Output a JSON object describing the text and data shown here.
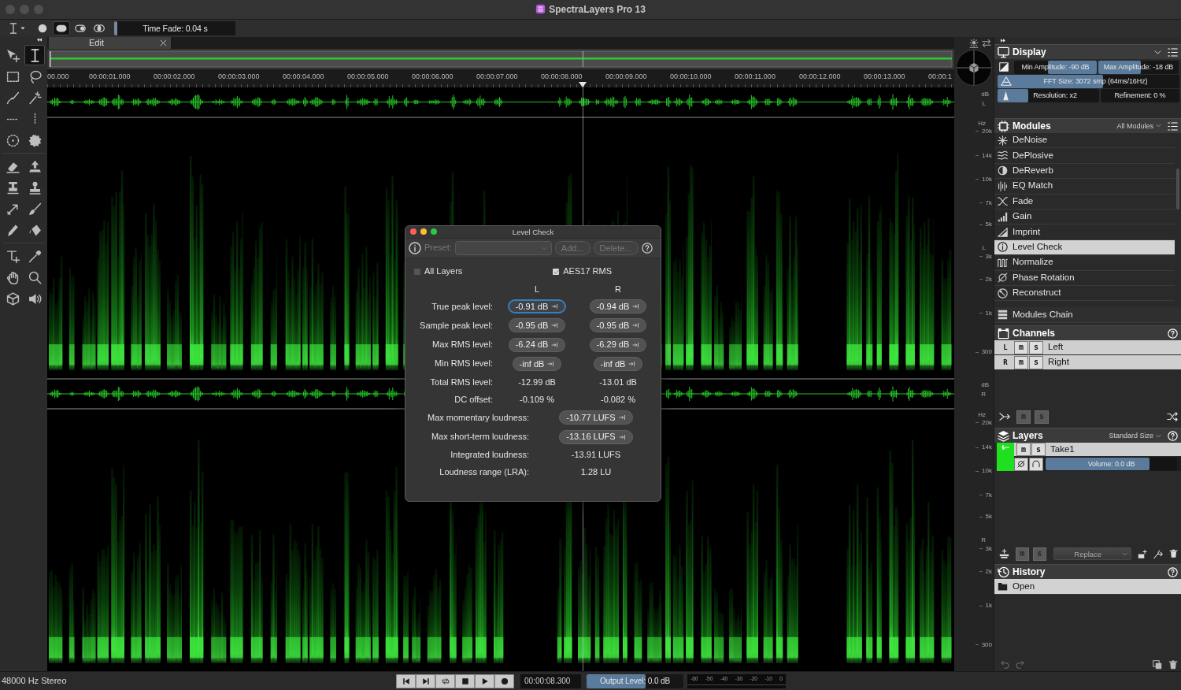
{
  "window": {
    "title": "SpectraLayers Pro 13"
  },
  "toolbar": {
    "modes": [
      {
        "selected": false
      },
      {
        "selected": true
      },
      {
        "selected": false
      },
      {
        "selected": false
      }
    ],
    "time_fade": {
      "label": "Time Fade: 0.04 s",
      "level": 0.02
    }
  },
  "tools": [
    {
      "selected": false
    },
    {
      "selected": true
    },
    {
      "selected": false
    },
    {
      "selected": false
    },
    {
      "selected": false
    },
    {
      "selected": false
    },
    {
      "selected": false
    },
    {
      "selected": false
    },
    {
      "selected": false
    },
    {
      "selected": false
    },
    {
      "selected": false
    },
    {
      "selected": false
    },
    {
      "selected": false
    },
    {
      "selected": false
    },
    {
      "selected": false
    },
    {
      "selected": false
    },
    {
      "selected": false
    },
    {
      "selected": false
    },
    {
      "selected": false
    },
    {
      "selected": false
    },
    {
      "selected": false
    },
    {
      "selected": false
    },
    {
      "selected": false
    },
    {
      "selected": false
    }
  ],
  "tabs": [
    {
      "label": "Edit",
      "selected": true
    }
  ],
  "ruler": {
    "labels": [
      "00.000",
      "00:00:01.000",
      "00:00:02.000",
      "00:00:03.000",
      "00:00:04.000",
      "00:00:05.000",
      "00:00:06.000",
      "00:00:07.000",
      "00:00:08.000",
      "00:00:09.000",
      "00:00:10.000",
      "00:00:11.000",
      "00:00:12.000",
      "00:00:13.000",
      "00:00:1"
    ]
  },
  "tracks": [
    {
      "amplitude_unit": "dB",
      "wave_label": "L",
      "frequency_unit": "Hz",
      "spectrum_label": "L",
      "frequency_labels": [
        "20k",
        "14k",
        "10k",
        "7k",
        "5k",
        "3k",
        "2k",
        "1k",
        "300"
      ]
    },
    {
      "amplitude_unit": "dB",
      "wave_label": "R",
      "frequency_unit": "Hz",
      "spectrum_label": "R",
      "frequency_labels": [
        "20k",
        "14k",
        "10k",
        "7k",
        "5k",
        "3k",
        "2k",
        "1k",
        "300"
      ]
    }
  ],
  "level_check": {
    "title": "Level Check",
    "preset": {
      "label": "Preset:",
      "disabled": true
    },
    "buttons": [
      {
        "label": "Add...",
        "disabled": true
      },
      {
        "label": "Delete...",
        "disabled": true
      }
    ],
    "options": [
      {
        "label": "All Layers",
        "checked": false
      },
      {
        "label": "AES17 RMS",
        "checked": true
      }
    ],
    "columns": [
      "L",
      "R"
    ],
    "rows": [
      {
        "label": "True peak level:",
        "values": [
          {
            "kind": "button",
            "text": "-0.91 dB",
            "focused": true
          },
          {
            "kind": "button",
            "text": "-0.94 dB",
            "focused": false
          }
        ]
      },
      {
        "label": "Sample peak level:",
        "values": [
          {
            "kind": "button",
            "text": "-0.95 dB",
            "focused": false
          },
          {
            "kind": "button",
            "text": "-0.95 dB",
            "focused": false
          }
        ]
      },
      {
        "label": "Max RMS level:",
        "values": [
          {
            "kind": "button",
            "text": "-6.24 dB",
            "focused": false
          },
          {
            "kind": "button",
            "text": "-6.29 dB",
            "focused": false
          }
        ]
      },
      {
        "label": "Min RMS level:",
        "values": [
          {
            "kind": "button",
            "text": "-inf dB",
            "focused": false
          },
          {
            "kind": "button",
            "text": "-inf dB",
            "focused": false
          }
        ]
      },
      {
        "label": "Total RMS level:",
        "values": [
          {
            "kind": "text",
            "text": "-12.99 dB"
          },
          {
            "kind": "text",
            "text": "-13.01 dB"
          }
        ]
      },
      {
        "label": "DC offset:",
        "values": [
          {
            "kind": "text",
            "text": "-0.109 %"
          },
          {
            "kind": "text",
            "text": "-0.082 %"
          }
        ]
      }
    ],
    "loudness": [
      {
        "label": "Max momentary loudness:",
        "value": {
          "kind": "button",
          "text": "-10.77 LUFS",
          "focused": false
        }
      },
      {
        "label": "Max short-term loudness:",
        "value": {
          "kind": "button",
          "text": "-13.16 LUFS",
          "focused": false
        }
      },
      {
        "label": "Integrated loudness:",
        "value": {
          "kind": "text",
          "text": "-13.91 LUFS"
        }
      },
      {
        "label": "Loudness range (LRA):",
        "value": {
          "kind": "text",
          "text": "1.28 LU"
        }
      }
    ]
  },
  "display": {
    "title": "Display",
    "amplitude": [
      {
        "label": "Min Amplitude: -90 dB",
        "level": 0.59,
        "reversed": true
      },
      {
        "label": "Max Amplitude: -18 dB",
        "level": 0.53,
        "reversed": false
      }
    ],
    "fft": {
      "label": "FFT Size: 3072 smp (64ms/16Hz)",
      "level": 0.58
    },
    "resolution": {
      "label": "Resolution: x2",
      "level": 0.3
    },
    "refinement": {
      "label": "Refinement: 0 %"
    }
  },
  "modules": {
    "title": "Modules",
    "filter": "All Modules",
    "items": [
      {
        "label": "DeNoise",
        "selected": false
      },
      {
        "label": "DePlosive",
        "selected": false
      },
      {
        "label": "DeReverb",
        "selected": false
      },
      {
        "label": "EQ Match",
        "selected": false
      },
      {
        "label": "Fade",
        "selected": false
      },
      {
        "label": "Gain",
        "selected": false
      },
      {
        "label": "Imprint",
        "selected": false
      },
      {
        "label": "Level Check",
        "selected": true
      },
      {
        "label": "Normalize",
        "selected": false
      },
      {
        "label": "Phase Rotation",
        "selected": false
      },
      {
        "label": "Reconstruct",
        "selected": false
      }
    ],
    "chain": "Modules Chain"
  },
  "channels": {
    "title": "Channels",
    "items": [
      {
        "letter": "L",
        "mute": "m",
        "solo": "s",
        "name": "Left"
      },
      {
        "letter": "R",
        "mute": "m",
        "solo": "s",
        "name": "Right"
      }
    ],
    "footer": {
      "mute": "m",
      "solo": "s"
    }
  },
  "layers": {
    "title": "Layers",
    "size": "Standard Size",
    "items": [
      {
        "name": "Take1",
        "mute": "m",
        "solo": "s",
        "volume": {
          "label": "Volume: 0.0 dB",
          "level": 0.79
        }
      }
    ],
    "footer": {
      "mute": "m",
      "solo": "s",
      "blend": {
        "label": "Replace",
        "disabled": true
      }
    }
  },
  "history": {
    "title": "History",
    "items": [
      {
        "label": "Open",
        "selected": true
      }
    ]
  },
  "status_bar": {
    "format": "48000 Hz Stereo",
    "time": "00:00:08.300",
    "output": {
      "label": "Output Level: 0.0 dB",
      "level": 0.61
    },
    "meter_scale": [
      "-60",
      "-50",
      "-40",
      "-30",
      "-20",
      "-10",
      "0"
    ]
  }
}
